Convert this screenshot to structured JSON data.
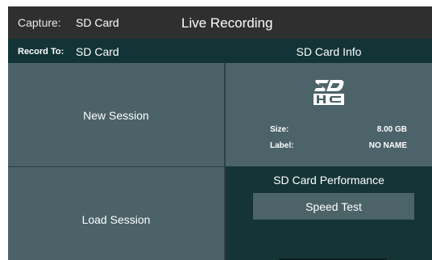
{
  "topbar": {
    "capture_label": "Capture:",
    "capture_value": "SD Card",
    "title": "Live Recording"
  },
  "record_bar": {
    "record_to_label": "Record To:",
    "record_to_value": "SD Card",
    "info_title": "SD Card Info"
  },
  "buttons": {
    "new_session": "New Session",
    "load_session": "Load Session"
  },
  "sd_info": {
    "logo_icon": "sdhc-logo-icon",
    "size_label": "Size:",
    "size_value": "8.00 GB",
    "label_label": "Label:",
    "label_value": "NO NAME"
  },
  "performance": {
    "title": "SD Card Performance",
    "speed_test_label": "Speed Test"
  },
  "colors": {
    "topbar": "#2f2f2f",
    "dark_teal": "#123436",
    "panel": "#4b6268"
  }
}
